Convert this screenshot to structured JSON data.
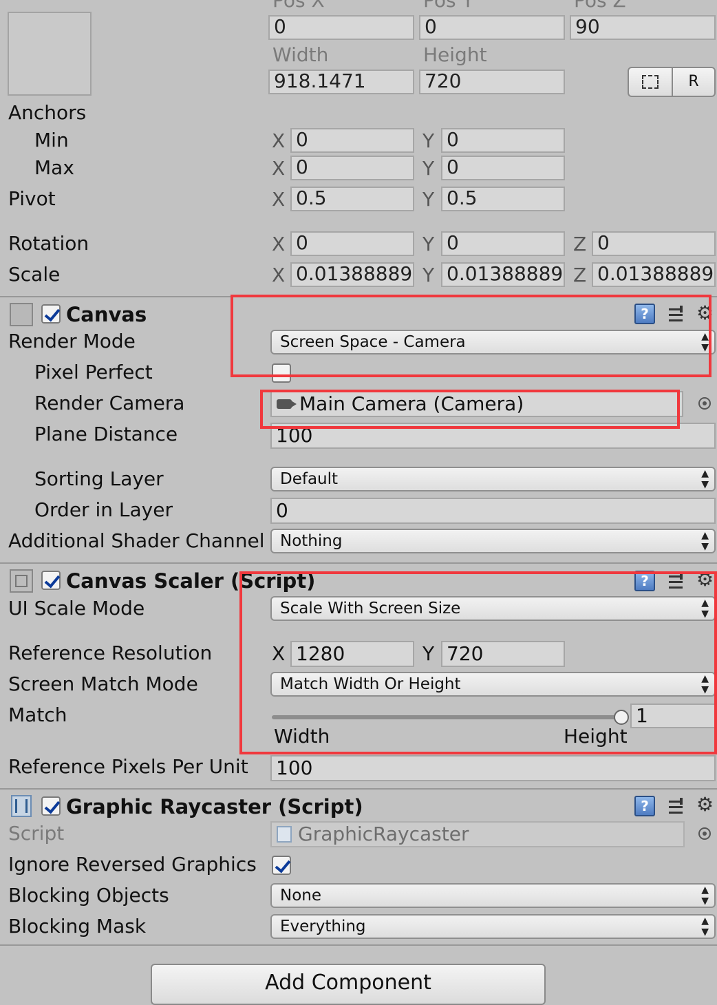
{
  "rect": {
    "pos_x_label": "Pos X",
    "pos_y_label": "Pos Y",
    "pos_z_label": "Pos Z",
    "pos_x": "0",
    "pos_y": "0",
    "pos_z": "90",
    "width_label": "Width",
    "height_label": "Height",
    "width": "918.1471",
    "height": "720",
    "raw_btn": "R",
    "anchors_label": "Anchors",
    "min_label": "Min",
    "min_x": "0",
    "min_y": "0",
    "max_label": "Max",
    "max_x": "0",
    "max_y": "0",
    "pivot_label": "Pivot",
    "pivot_x": "0.5",
    "pivot_y": "0.5",
    "rotation_label": "Rotation",
    "rot_x": "0",
    "rot_y": "0",
    "rot_z": "0",
    "scale_label": "Scale",
    "scale_x": "0.01388889",
    "scale_y": "0.01388889",
    "scale_z": "0.01388889",
    "axis_x": "X",
    "axis_y": "Y",
    "axis_z": "Z"
  },
  "canvas": {
    "title": "Canvas",
    "render_mode_label": "Render Mode",
    "render_mode": "Screen Space - Camera",
    "pixel_perfect_label": "Pixel Perfect",
    "render_camera_label": "Render Camera",
    "render_camera": "Main Camera (Camera)",
    "plane_distance_label": "Plane Distance",
    "plane_distance": "100",
    "sorting_layer_label": "Sorting Layer",
    "sorting_layer": "Default",
    "order_label": "Order in Layer",
    "order": "0",
    "shader_label": "Additional Shader Channel",
    "shader": "Nothing"
  },
  "scaler": {
    "title": "Canvas Scaler (Script)",
    "ui_scale_label": "UI Scale Mode",
    "ui_scale": "Scale With Screen Size",
    "ref_res_label": "Reference Resolution",
    "ref_x": "1280",
    "ref_y": "720",
    "match_mode_label": "Screen Match Mode",
    "match_mode": "Match Width Or Height",
    "match_label": "Match",
    "match_value": "1",
    "match_fraction": 1.0,
    "width_caption": "Width",
    "height_caption": "Height",
    "ppu_label": "Reference Pixels Per Unit",
    "ppu": "100"
  },
  "raycaster": {
    "title": "Graphic Raycaster (Script)",
    "script_label": "Script",
    "script": "GraphicRaycaster",
    "ignore_label": "Ignore Reversed Graphics",
    "blocking_objects_label": "Blocking Objects",
    "blocking_objects": "None",
    "blocking_mask_label": "Blocking Mask",
    "blocking_mask": "Everything"
  },
  "add_component": "Add Component",
  "help_glyph": "?",
  "dropdown_arrow": "▲▼",
  "colors": {
    "highlight": "#f0383d",
    "check": "#0b3a99"
  }
}
